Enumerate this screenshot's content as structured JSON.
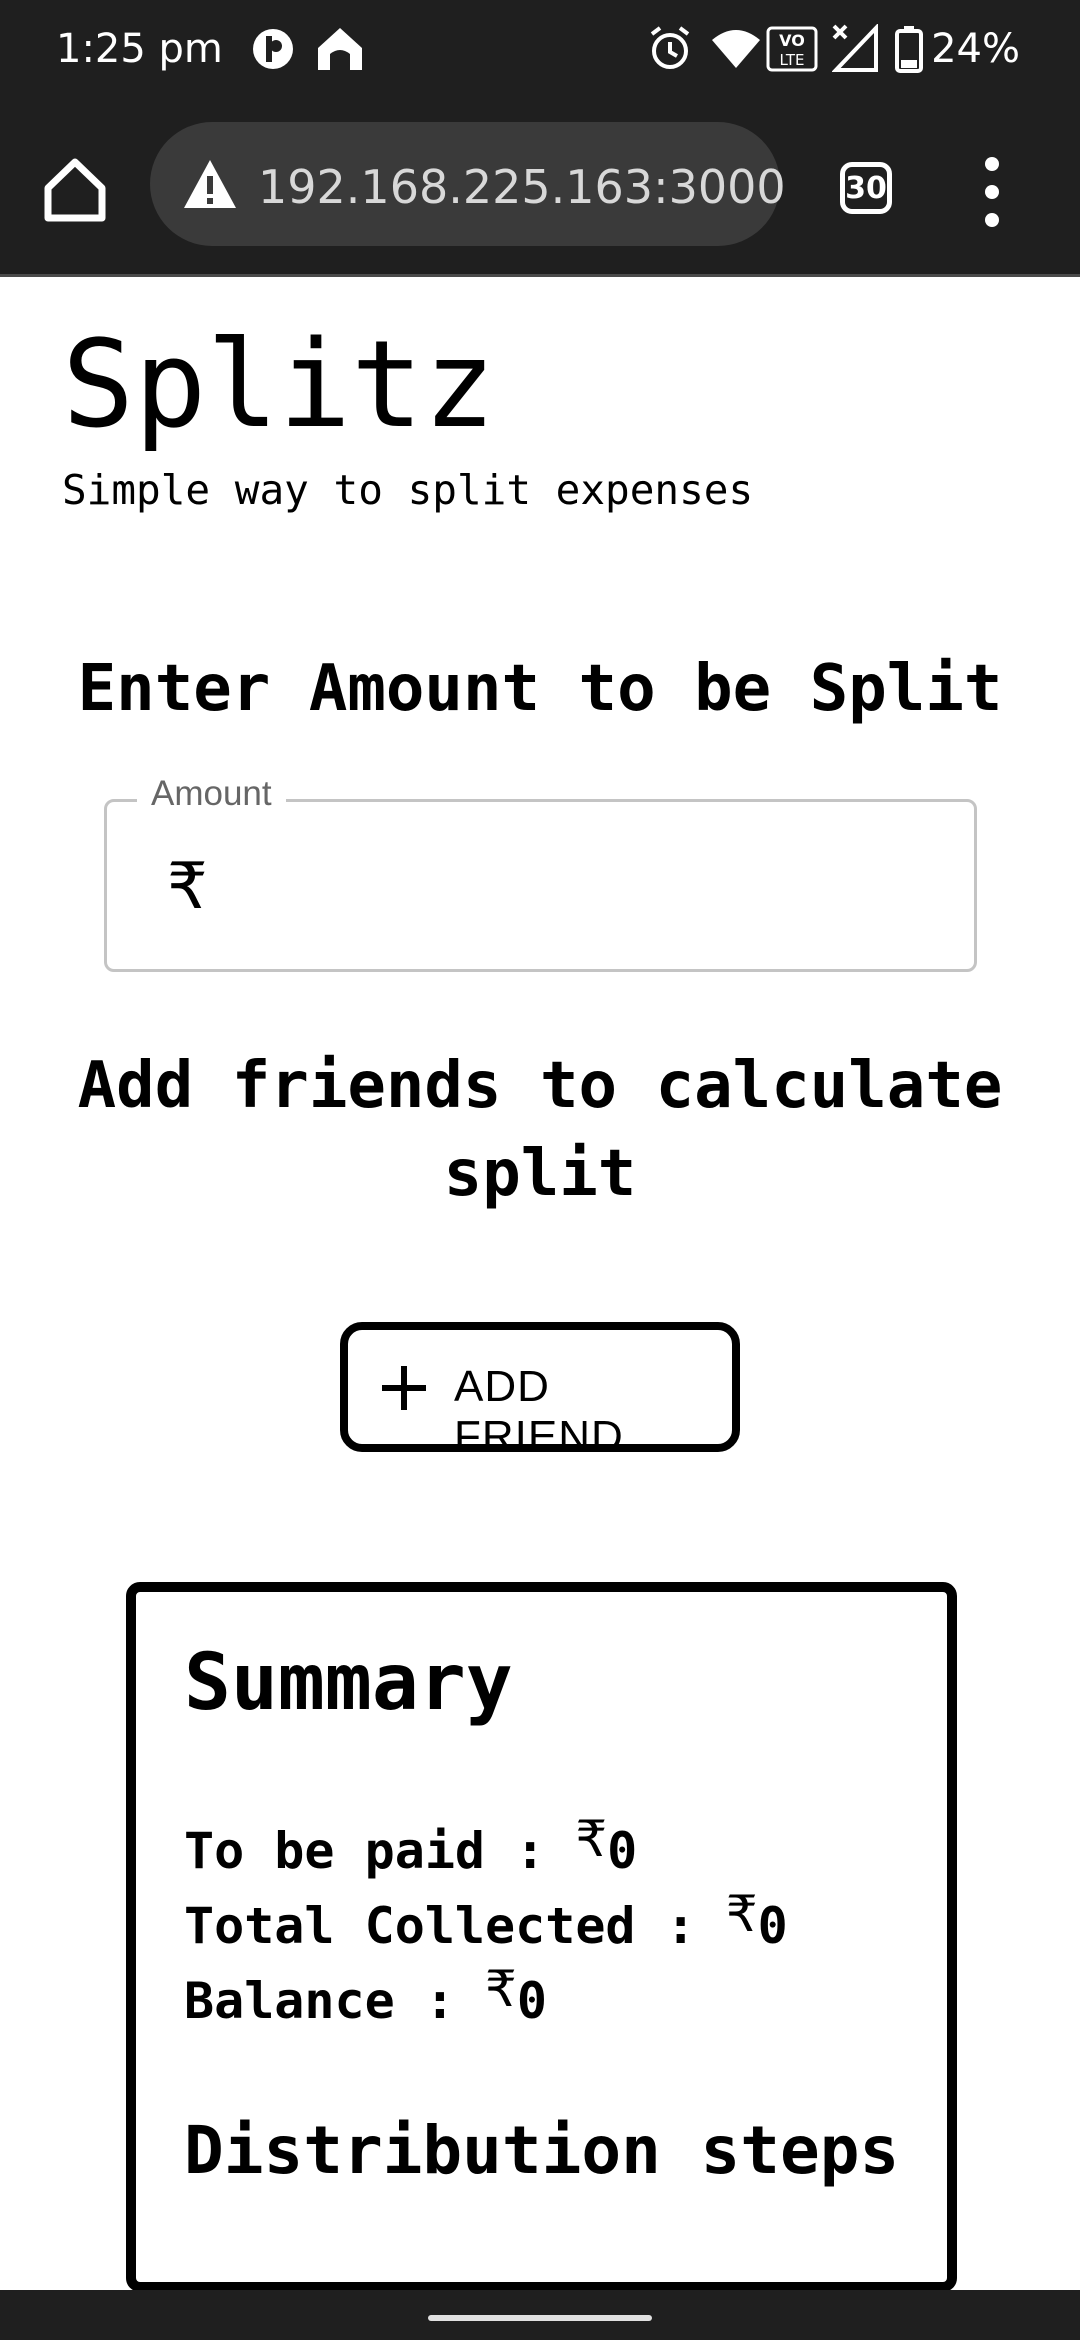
{
  "status_bar": {
    "time": "1:25 pm",
    "battery": "24%",
    "icons": [
      "app-notification-icon",
      "home-notification-icon",
      "alarm-icon",
      "wifi-icon",
      "volte-icon",
      "signal-icon",
      "battery-icon"
    ],
    "volte_text": "VO LTE"
  },
  "browser": {
    "url": "192.168.225.163:3000",
    "tab_count": "30",
    "icons": [
      "home-icon",
      "warning-icon",
      "menu-icon"
    ]
  },
  "app": {
    "title": "Splitz",
    "subtitle": "Simple way to split expenses"
  },
  "amount_section": {
    "heading": "Enter Amount to be Split",
    "field_label": "Amount",
    "currency_prefix": "₹",
    "value": ""
  },
  "friends_section": {
    "heading": "Add friends to calculate split",
    "add_button_label": "ADD FRIEND"
  },
  "summary": {
    "title": "Summary",
    "currency": "₹",
    "to_be_paid_label": "To be paid : ",
    "to_be_paid_value": "0",
    "total_collected_label": "Total Collected : ",
    "total_collected_value": "0",
    "balance_label": "Balance : ",
    "balance_value": "0",
    "distribution_title": "Distribution steps"
  }
}
